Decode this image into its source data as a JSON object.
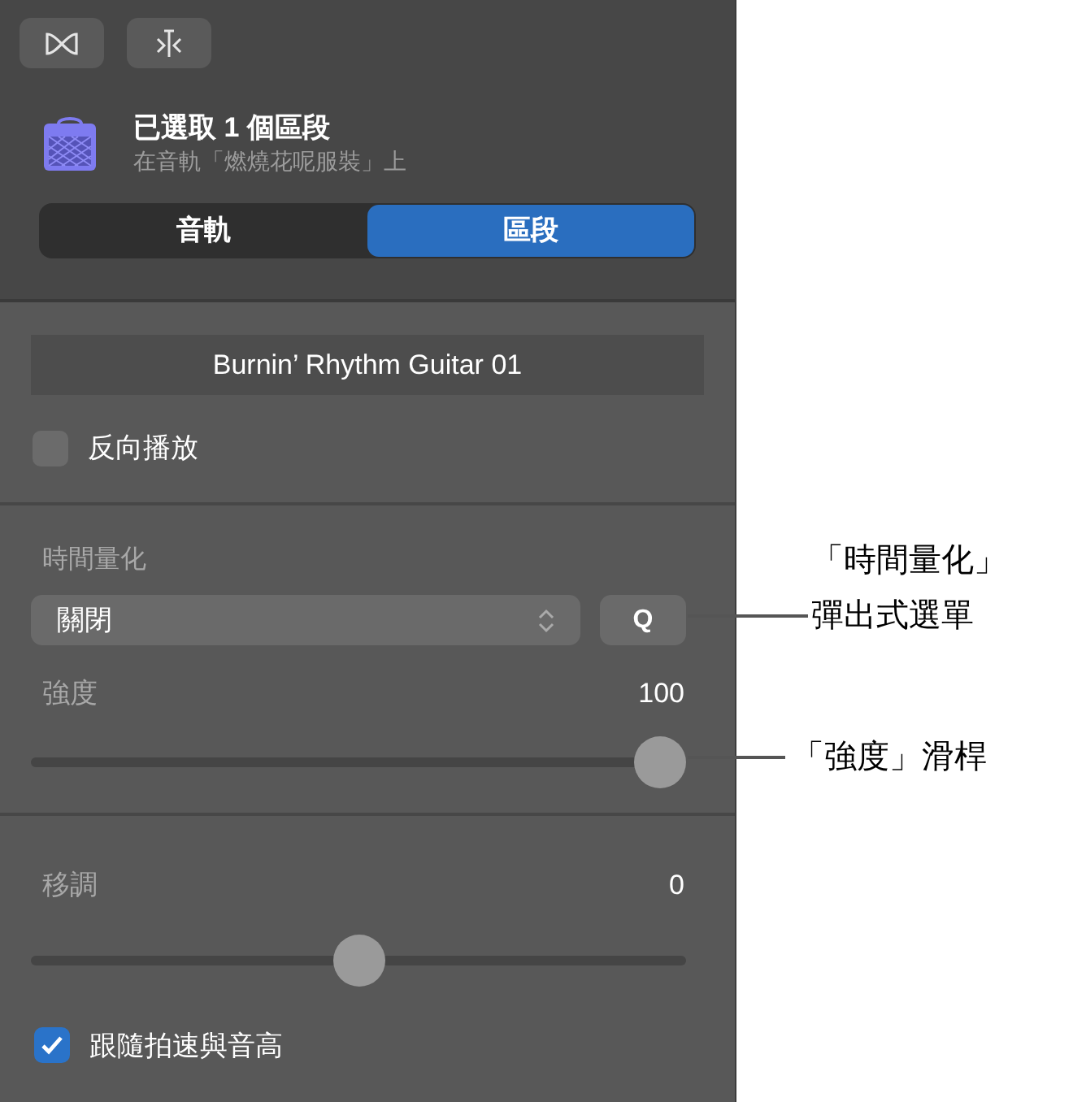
{
  "toolbar": {
    "buttons": [
      {
        "kind": "loop"
      },
      {
        "kind": "split"
      }
    ]
  },
  "header": {
    "title": "已選取 1 個區段",
    "subtitle": "在音軌「燃燒花呢服裝」上"
  },
  "tabs": [
    {
      "label": "音軌",
      "selected": false
    },
    {
      "label": "區段",
      "selected": true
    }
  ],
  "region_name": {
    "value": "Burnin’ Rhythm Guitar 01"
  },
  "reverse": {
    "label": "反向播放",
    "checked": false
  },
  "quantize": {
    "label": "時間量化",
    "value": "關閉",
    "button": "Q"
  },
  "strength": {
    "label": "強度",
    "reading": "100",
    "level": 1
  },
  "transpose": {
    "label": "移調",
    "reading": "0",
    "level": 0.5
  },
  "follow": {
    "label": "跟隨拍速與音高",
    "checked": true
  },
  "callouts": [
    {
      "lines": [
        "「時間量化」",
        "彈出式選單"
      ],
      "kind": "quantize"
    },
    {
      "lines": [
        "「強度」滑桿"
      ],
      "kind": "strength"
    }
  ]
}
